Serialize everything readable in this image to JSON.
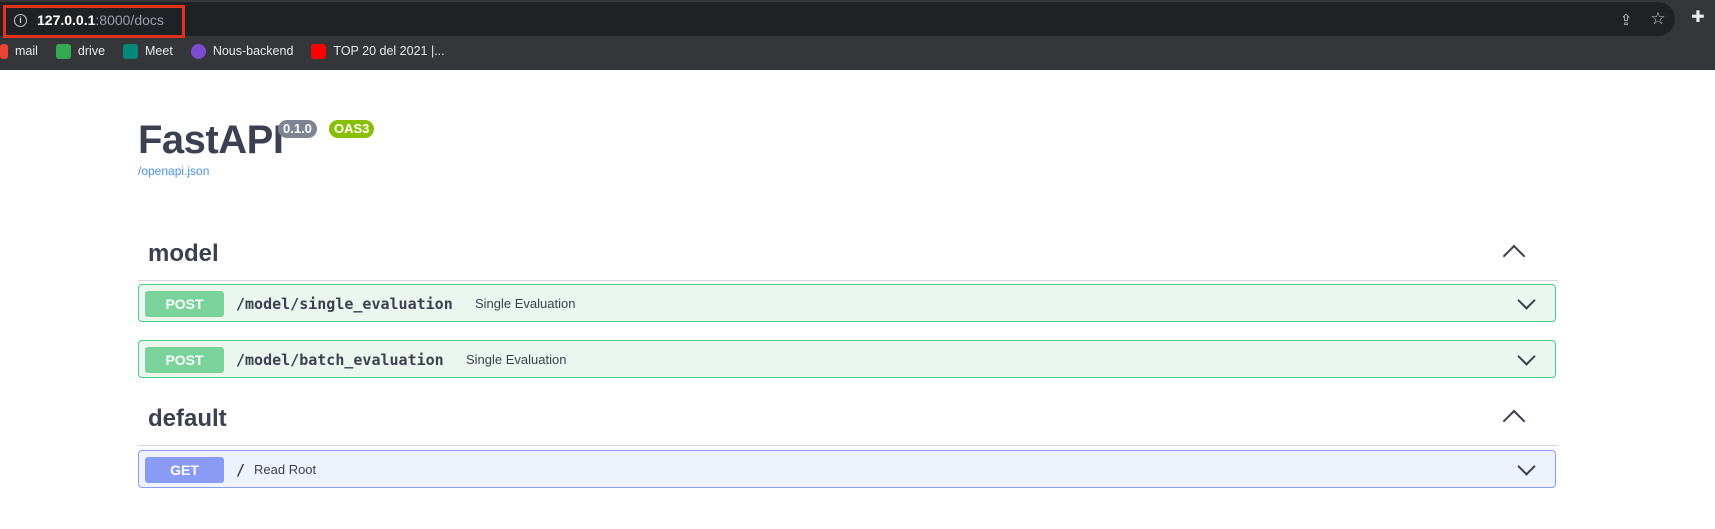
{
  "browser": {
    "url_host": "127.0.0.1",
    "url_rest": ":8000/docs",
    "bookmarks": [
      {
        "label": "mail",
        "icon": "gmail-icon",
        "color": "#ea4335"
      },
      {
        "label": "drive",
        "icon": "drive-icon",
        "color": "#34a853"
      },
      {
        "label": "Meet",
        "icon": "meet-icon",
        "color": "#00897b"
      },
      {
        "label": "Nous-backend",
        "icon": "nous-icon",
        "color": "#7b4cd0"
      },
      {
        "label": "TOP 20 del 2021 |...",
        "icon": "youtube-icon",
        "color": "#ff0000"
      }
    ]
  },
  "api": {
    "title": "FastAPI",
    "version": "0.1.0",
    "oas": "OAS3",
    "spec_link": "/openapi.json"
  },
  "sections": [
    {
      "name": "model",
      "operations": [
        {
          "method": "POST",
          "path": "/model/single_evaluation",
          "summary": "Single Evaluation"
        },
        {
          "method": "POST",
          "path": "/model/batch_evaluation",
          "summary": "Single Evaluation"
        }
      ]
    },
    {
      "name": "default",
      "operations": [
        {
          "method": "GET",
          "path": "/",
          "summary": "Read Root"
        }
      ]
    }
  ],
  "colors": {
    "post": "#49cc90",
    "get": "#8a9bf5",
    "version_badge": "#7d8492",
    "oas_badge": "#89bf04"
  }
}
